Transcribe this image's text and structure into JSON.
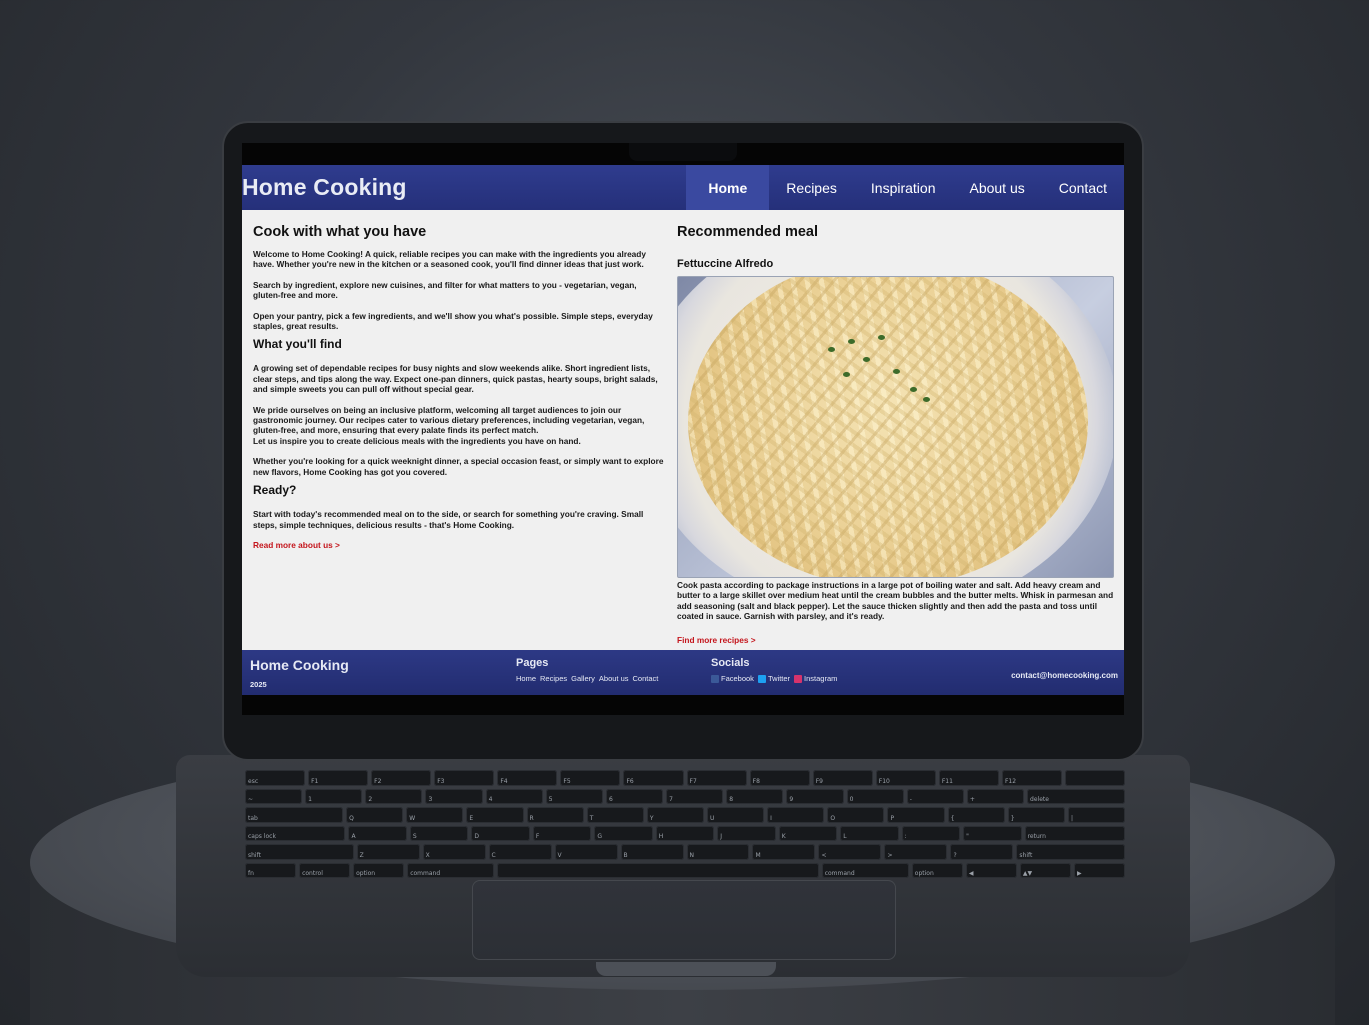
{
  "site": {
    "brand": "Home Cooking",
    "nav": [
      {
        "label": "Home",
        "active": true
      },
      {
        "label": "Recipes"
      },
      {
        "label": "Inspiration"
      },
      {
        "label": "About us"
      },
      {
        "label": "Contact"
      }
    ]
  },
  "intro": {
    "title": "Cook with what you have",
    "paragraphs": [
      "Welcome to Home Cooking! A quick, reliable recipes you can make with the ingredients you already have. Whether you're new in the kitchen or a seasoned cook, you'll find dinner ideas that just work.",
      "Search by ingredient, explore new cuisines, and filter for what matters to you - vegetarian, vegan, gluten-free and more.",
      "Open your pantry, pick a few ingredients, and we'll show you what's possible. Simple steps, everyday staples, great results."
    ]
  },
  "find": {
    "title": "What you'll find",
    "paragraphs": [
      "A growing set of dependable recipes for busy nights and slow weekends alike. Short ingredient lists, clear steps, and tips along the way. Expect one-pan dinners, quick pastas, hearty soups, bright salads, and simple sweets you can pull off without special gear.",
      "We pride ourselves on being an inclusive platform, welcoming all target audiences to join our gastronomic journey. Our recipes cater to various dietary preferences, including vegetarian, vegan, gluten-free, and more, ensuring that every palate finds its perfect match.",
      "Let us inspire you to create delicious meals with the ingredients you have on hand.",
      "Whether you're looking for a quick weeknight dinner, a special occasion feast, or simply want to explore new flavors, Home Cooking has got you covered."
    ]
  },
  "ready": {
    "title": "Ready?",
    "paragraph": "Start with today's recommended meal on to the side, or search for something you're craving. Small steps, simple techniques, delicious results - that's Home Cooking.",
    "link": "Read more about us >"
  },
  "recommended": {
    "title": "Recommended meal",
    "meal": "Fettuccine Alfredo",
    "description": "Cook pasta according to package instructions in a large pot of boiling water and salt. Add heavy cream and butter to a large skillet over medium heat until the cream bubbles and the butter melts. Whisk in parmesan and add seasoning (salt and black pepper). Let the sauce thicken slightly and then add the pasta and toss until coated in sauce. Garnish with parsley, and it's ready.",
    "link": "Find more recipes >"
  },
  "footer": {
    "brand": "Home Cooking",
    "year": "2025",
    "pages_title": "Pages",
    "pages": [
      "Home",
      "Recipes",
      "Gallery",
      "About us",
      "Contact"
    ],
    "socials_title": "Socials",
    "socials": [
      {
        "label": "Facebook",
        "icon": "facebook-icon",
        "color": "#3b5998"
      },
      {
        "label": "Twitter",
        "icon": "twitter-icon",
        "color": "#1da1f2"
      },
      {
        "label": "Instagram",
        "icon": "instagram-icon",
        "color": "#d6336c"
      }
    ],
    "email": "contact@homecooking.com"
  },
  "keyboard": {
    "rows": [
      [
        "esc",
        "F1",
        "F2",
        "F3",
        "F4",
        "F5",
        "F6",
        "F7",
        "F8",
        "F9",
        "F10",
        "F11",
        "F12",
        ""
      ],
      [
        "~",
        "1",
        "2",
        "3",
        "4",
        "5",
        "6",
        "7",
        "8",
        "9",
        "0",
        "-",
        "+",
        "delete"
      ],
      [
        "tab",
        "Q",
        "W",
        "E",
        "R",
        "T",
        "Y",
        "U",
        "I",
        "O",
        "P",
        "{",
        "}",
        "|"
      ],
      [
        "caps lock",
        "A",
        "S",
        "D",
        "F",
        "G",
        "H",
        "J",
        "K",
        "L",
        ":",
        "\"",
        "return"
      ],
      [
        "shift",
        "Z",
        "X",
        "C",
        "V",
        "B",
        "N",
        "M",
        "<",
        ">",
        "?",
        "shift"
      ],
      [
        "fn",
        "control",
        "option",
        "command",
        "",
        "command",
        "option",
        "◀",
        "▲▼",
        "▶"
      ]
    ]
  },
  "colors": {
    "nav": "#2f3c8e",
    "link": "#c4151c"
  }
}
